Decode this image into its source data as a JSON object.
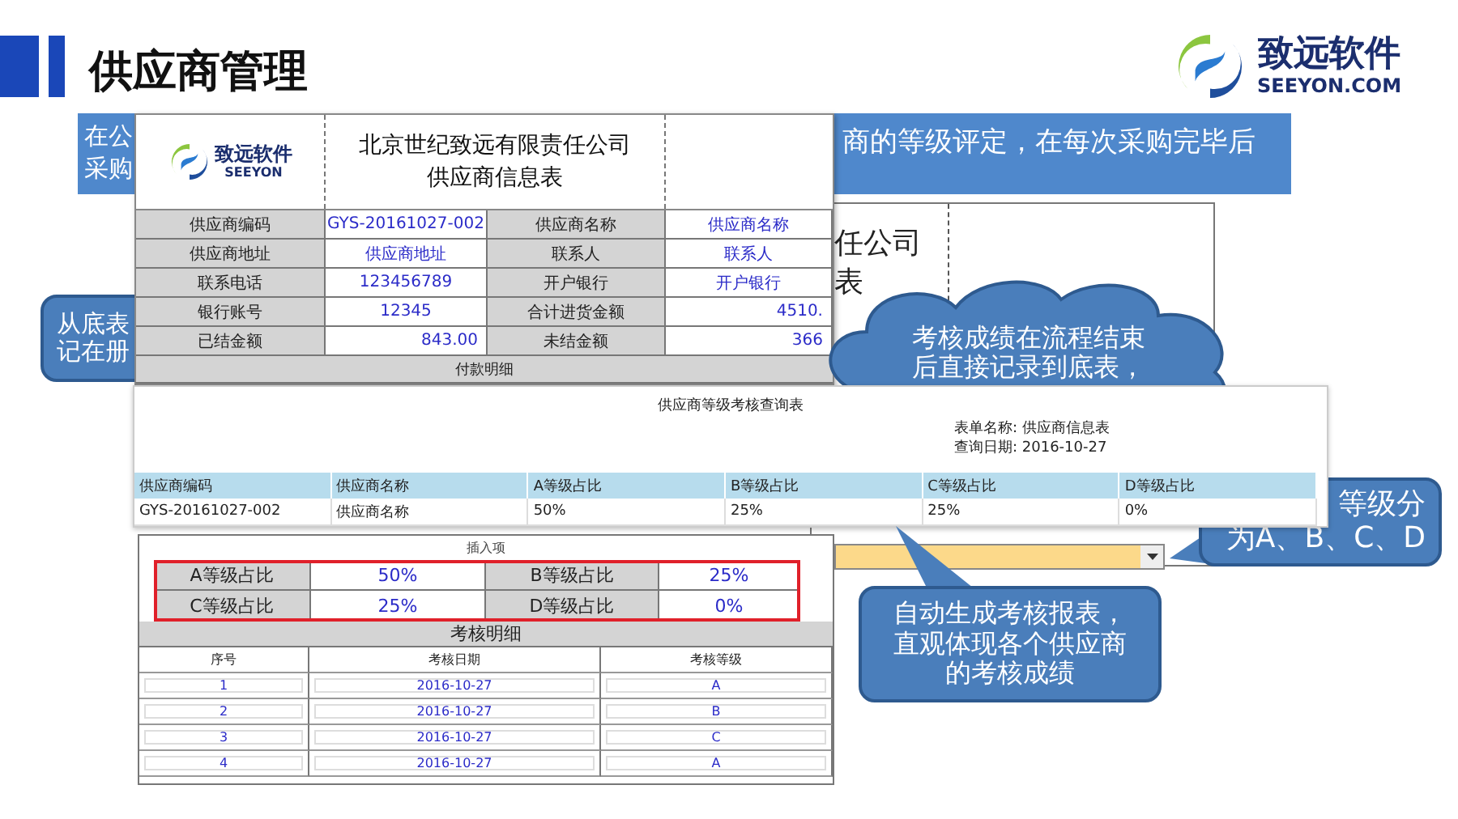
{
  "title": "供应商管理",
  "logo": {
    "name": "致远软件",
    "domain": "SEEYON.COM"
  },
  "banner": {
    "left_lines": [
      "在公",
      "采购"
    ],
    "right_line": "商的等级评定，在每次采购完毕后"
  },
  "back_form": {
    "fragments": [
      "任公司",
      "表"
    ]
  },
  "callouts": [
    {
      "kind": "rounded",
      "lines": [
        "从底表",
        "记在册"
      ]
    },
    {
      "kind": "cloud",
      "lines": [
        "考核成绩在流程结束",
        "后直接记录到底表，"
      ]
    },
    {
      "kind": "rounded",
      "lines": [
        "等级分",
        "为A、B、C、D"
      ]
    },
    {
      "kind": "rounded",
      "lines": [
        "自动生成考核报表，",
        "直观体现各个供应商",
        "的考核成绩"
      ]
    }
  ],
  "info_form": {
    "logo": {
      "name": "致远软件",
      "sub": "SEEYON"
    },
    "company": "北京世纪致远有限责任公司",
    "form_title": "供应商信息表",
    "rows": [
      [
        "供应商编码",
        "GYS-20161027-002",
        "供应商名称",
        "供应商名称"
      ],
      [
        "供应商地址",
        "供应商地址",
        "联系人",
        "联系人"
      ],
      [
        "联系电话",
        "123456789",
        "开户银行",
        "开户银行"
      ],
      [
        "银行账号",
        "12345",
        "合计进货金额",
        "4510."
      ],
      [
        "已结金额",
        "843.00",
        "未结金额",
        "366"
      ]
    ],
    "section": "付款明细"
  },
  "report": {
    "title": "供应商等级考核查询表",
    "form_name": "表单名称: 供应商信息表",
    "query_date": "查询日期: 2016-10-27",
    "columns": [
      "供应商编码",
      "供应商名称",
      "A等级占比",
      "B等级占比",
      "C等级占比",
      "D等级占比"
    ],
    "rows": [
      [
        "GYS-20161027-002",
        "供应商名称",
        "50%",
        "25%",
        "25%",
        "0%"
      ]
    ]
  },
  "grade_form": {
    "insert_label": "插入项",
    "ratios": [
      {
        "label": "A等级占比",
        "value": "50%"
      },
      {
        "label": "B等级占比",
        "value": "25%"
      },
      {
        "label": "C等级占比",
        "value": "25%"
      },
      {
        "label": "D等级占比",
        "value": "0%"
      }
    ],
    "detail_title": "考核明细",
    "detail_columns": [
      "序号",
      "考核日期",
      "考核等级"
    ],
    "detail_rows": [
      [
        "1",
        "2016-10-27",
        "A"
      ],
      [
        "2",
        "2016-10-27",
        "B"
      ],
      [
        "3",
        "2016-10-27",
        "C"
      ],
      [
        "4",
        "2016-10-27",
        "A"
      ]
    ]
  }
}
